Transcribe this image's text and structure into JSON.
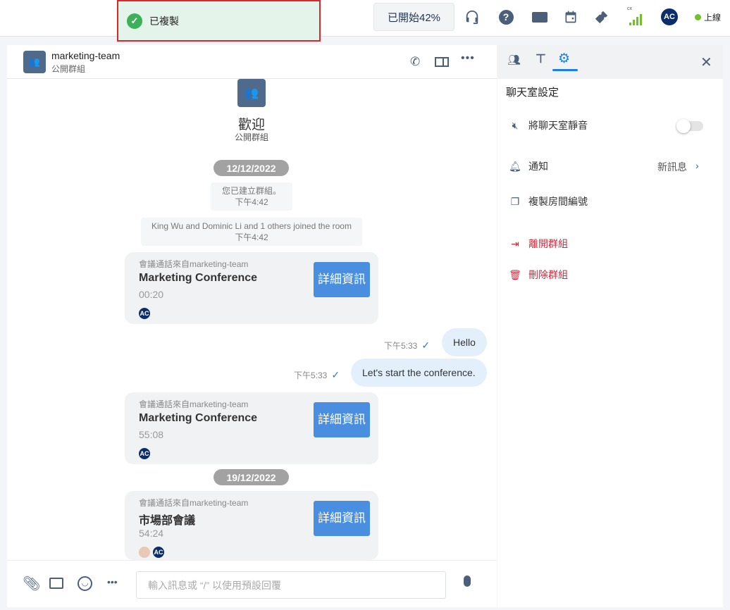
{
  "toast": {
    "message": "已複製",
    "icon": "check-circle-icon"
  },
  "topbar": {
    "start_label": "已開始42%",
    "signal_label": "cx",
    "user_initials": "AC",
    "status": "上線",
    "status_color": "#72c02c"
  },
  "chat": {
    "room_name": "marketing-team",
    "room_type": "公開群組",
    "welcome_title": "歡迎",
    "welcome_sub": "公開群組",
    "dates": [
      "12/12/2022",
      "19/12/2022"
    ],
    "system": [
      {
        "text": "您已建立群組。",
        "time": "下午4:42"
      },
      {
        "text": "King Wu and Dominic Li and 1 others joined the room",
        "time": "下午4:42"
      }
    ],
    "calls": [
      {
        "from": "會議通話來自marketing-team",
        "title": "Marketing Conference",
        "duration": "00:20",
        "details": "詳細資訊",
        "avatar": "AC"
      },
      {
        "from": "會議通話來自marketing-team",
        "title": "Marketing Conference",
        "duration": "55:08",
        "details": "詳細資訊",
        "avatar": "AC"
      },
      {
        "from": "會議通話來自marketing-team",
        "title": "市場部會議",
        "duration": "54:24",
        "details": "詳細資訊",
        "avatar": "AC"
      }
    ],
    "messages": [
      {
        "text": "Hello",
        "time": "下午5:33"
      },
      {
        "text": "Let's start the conference.",
        "time": "下午5:33"
      }
    ],
    "input_placeholder": "輸入訊息或 “/” 以使用預設回覆"
  },
  "side": {
    "title": "聊天室設定",
    "mute_label": "將聊天室靜音",
    "mute_on": false,
    "notify_label": "通知",
    "notify_value": "新訊息",
    "copy_label": "複製房間編號",
    "leave_label": "離開群組",
    "delete_label": "刪除群組",
    "accent": "#1a7fe8",
    "danger": "#d3283b"
  }
}
